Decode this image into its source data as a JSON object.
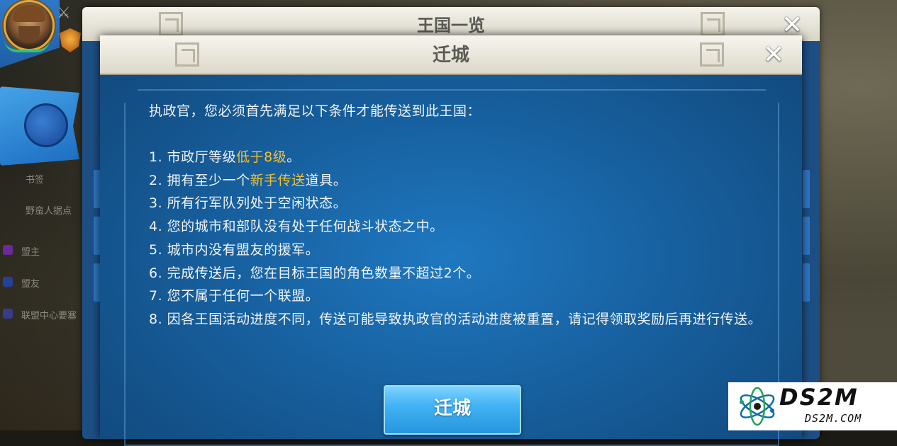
{
  "background": {
    "sidebar_items": [
      "书签",
      "野蛮人据点",
      "盟主",
      "盟友",
      "联盟中心要塞"
    ],
    "sidebar_colors": [
      "#6b2a9a",
      "#24419a",
      "#3a3a8a"
    ]
  },
  "back_dialog": {
    "title": "王国一览",
    "close_icon": "close-icon"
  },
  "dialog": {
    "title": "迁城",
    "close_icon": "close-icon",
    "intro": "执政官，您必须首先满足以下条件才能传送到此王国：",
    "conditions": [
      {
        "pre": "1. 市政厅等级",
        "hl": "低于8级",
        "post": "。"
      },
      {
        "pre": "2. 拥有至少一个",
        "hl": "新手传送",
        "post": "道具。"
      },
      {
        "pre": "3. 所有行军队列处于空闲状态。",
        "hl": "",
        "post": ""
      },
      {
        "pre": "4. 您的城市和部队没有处于任何战斗状态之中。",
        "hl": "",
        "post": ""
      },
      {
        "pre": "5. 城市内没有盟友的援军。",
        "hl": "",
        "post": ""
      },
      {
        "pre": "6. 完成传送后，您在目标王国的角色数量不超过2个。",
        "hl": "",
        "post": ""
      },
      {
        "pre": "7. 您不属于任何一个联盟。",
        "hl": "",
        "post": ""
      },
      {
        "pre": "8. 因各王国活动进度不同，传送可能导致执政官的活动进度被重置，请记得领取奖励后再进行传送。",
        "hl": "",
        "post": ""
      }
    ],
    "button_label": "迁城",
    "highlight_color": "#f1c232"
  },
  "watermark": {
    "brand": "DS2M",
    "domain": "DS2M.COM"
  }
}
